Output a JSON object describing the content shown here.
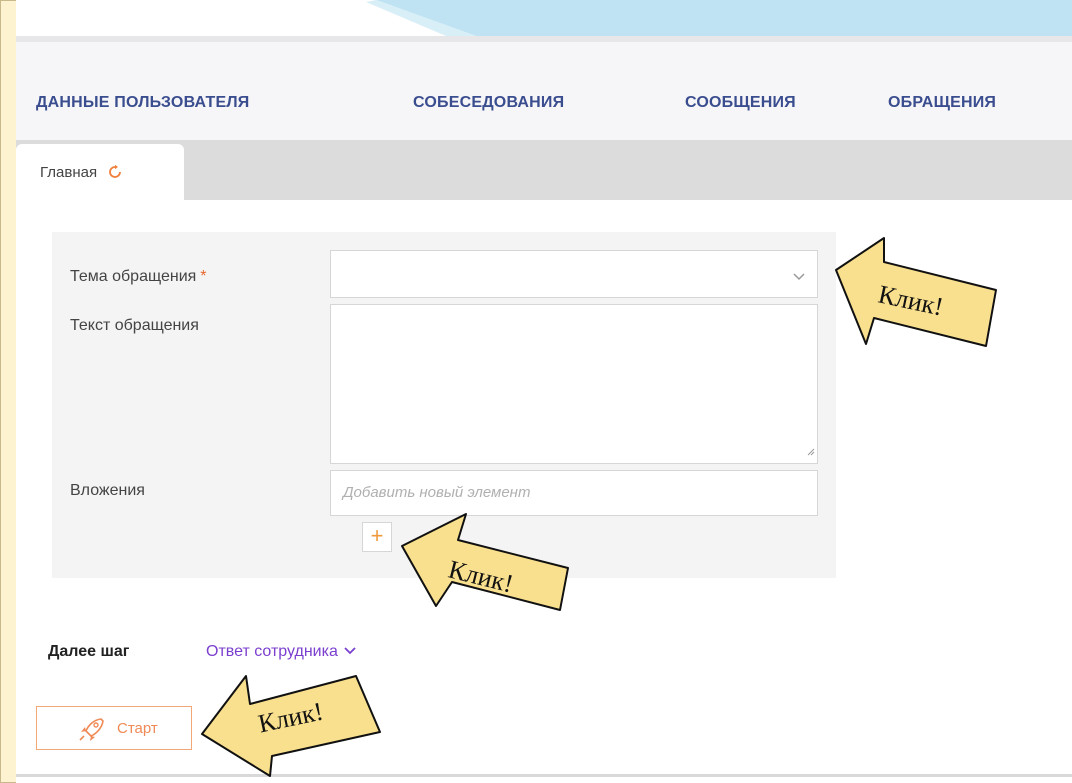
{
  "nav": {
    "items": [
      {
        "label": "ДАННЫЕ ПОЛЬЗОВАТЕЛЯ"
      },
      {
        "label": "СОБЕСЕДОВАНИЯ"
      },
      {
        "label": "СООБЩЕНИЯ"
      },
      {
        "label": "ОБРАЩЕНИЯ"
      }
    ]
  },
  "tabs": [
    {
      "label": "Главная",
      "icon": "refresh-icon"
    }
  ],
  "form": {
    "topic": {
      "label": "Тема обращения",
      "required_mark": "*",
      "value": ""
    },
    "text": {
      "label": "Текст обращения",
      "value": ""
    },
    "attachments": {
      "label": "Вложения",
      "placeholder": "Добавить новый элемент",
      "add_symbol": "+"
    }
  },
  "next_step": {
    "label": "Далее шаг",
    "value": "Ответ сотрудника"
  },
  "start_button": {
    "label": "Старт",
    "icon": "rocket-icon"
  },
  "annotations": [
    {
      "text": "Клик!"
    },
    {
      "text": "Клик!"
    },
    {
      "text": "Клик!"
    }
  ],
  "colors": {
    "nav_text": "#3a4d8f",
    "accent_orange": "#ef8a56",
    "link_purple": "#7b3fcf",
    "arrow_fill": "#f9e08e",
    "background": "#fdf3d0"
  }
}
